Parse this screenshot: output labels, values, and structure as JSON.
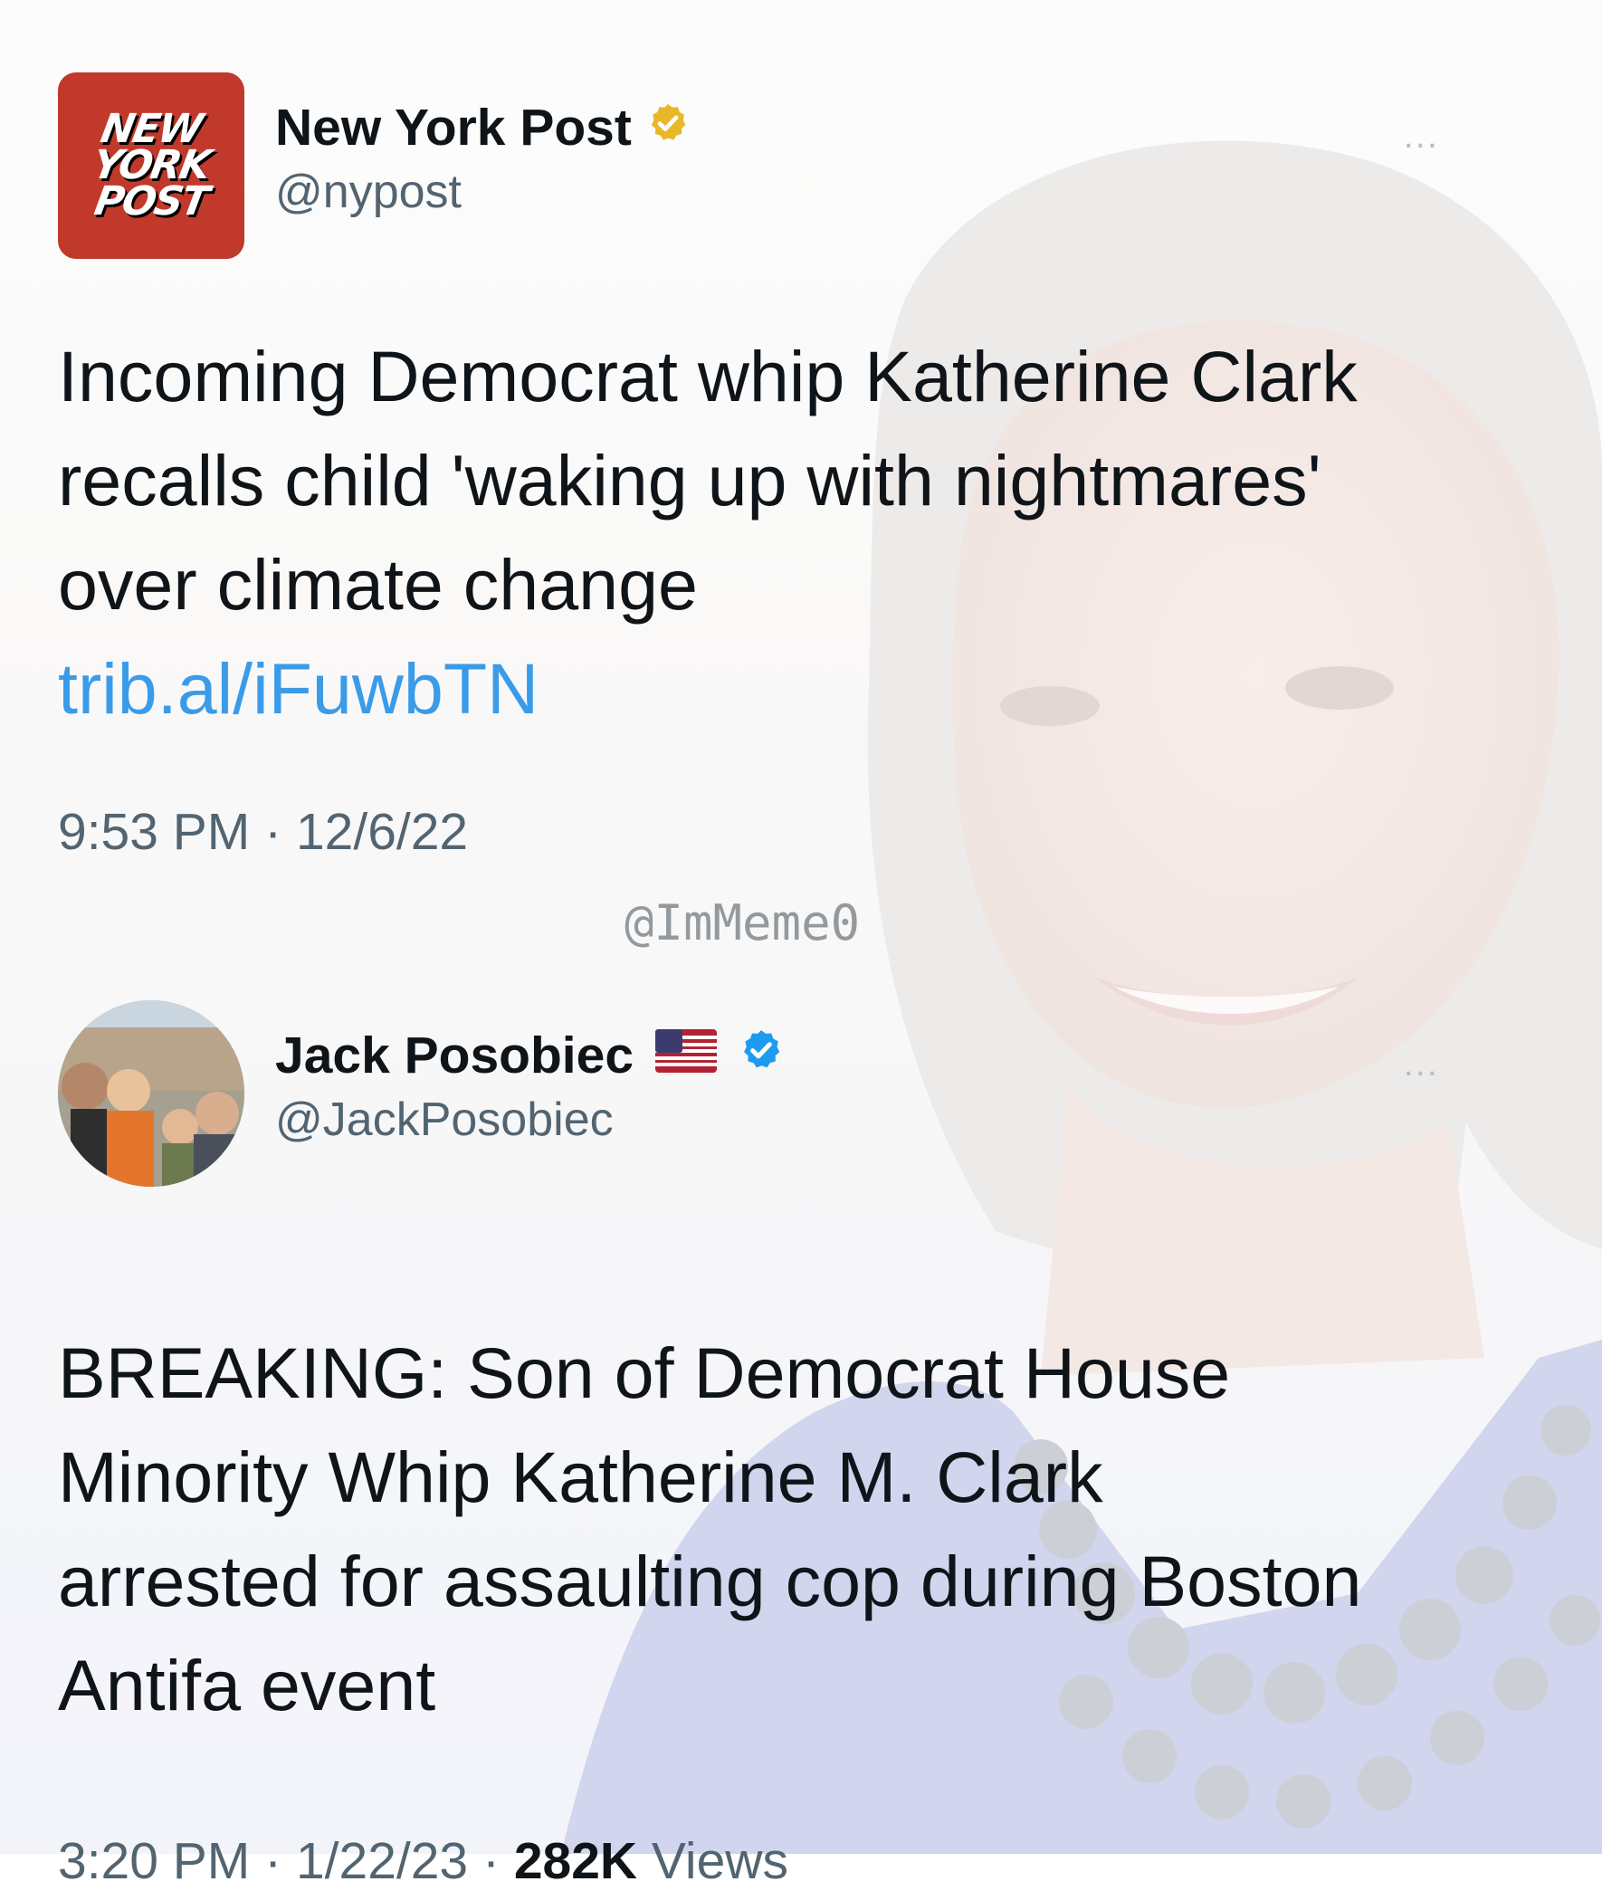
{
  "tweets": [
    {
      "author_name": "New York Post",
      "handle": "@nypost",
      "logo_lines": [
        "NEW",
        "YORK",
        "POST"
      ],
      "badge": "gold-verified",
      "text": "Incoming Democrat whip Katherine Clark recalls child 'waking up with nightmares' over climate change",
      "link": "trib.al/iFuwbTN",
      "time": "9:53 PM",
      "date": "12/6/22",
      "more_label": "..."
    },
    {
      "author_name": "Jack Posobiec",
      "handle": "@JackPosobiec",
      "badge": "blue-verified",
      "flag": "us-flag",
      "text": "BREAKING: Son of Democrat House Minority Whip Katherine M. Clark arrested for assaulting cop during Boston Antifa event",
      "time": "3:20 PM",
      "date": "1/22/23",
      "views_count": "282K",
      "views_label": "Views",
      "more_label": "..."
    }
  ],
  "separator": "·",
  "watermark": "@ImMeme0",
  "colors": {
    "link": "#3a9be8",
    "handle": "#536471",
    "gold_badge": "#e8b829",
    "blue_badge": "#1d9bf0",
    "nyp_red": "#c0392b"
  }
}
